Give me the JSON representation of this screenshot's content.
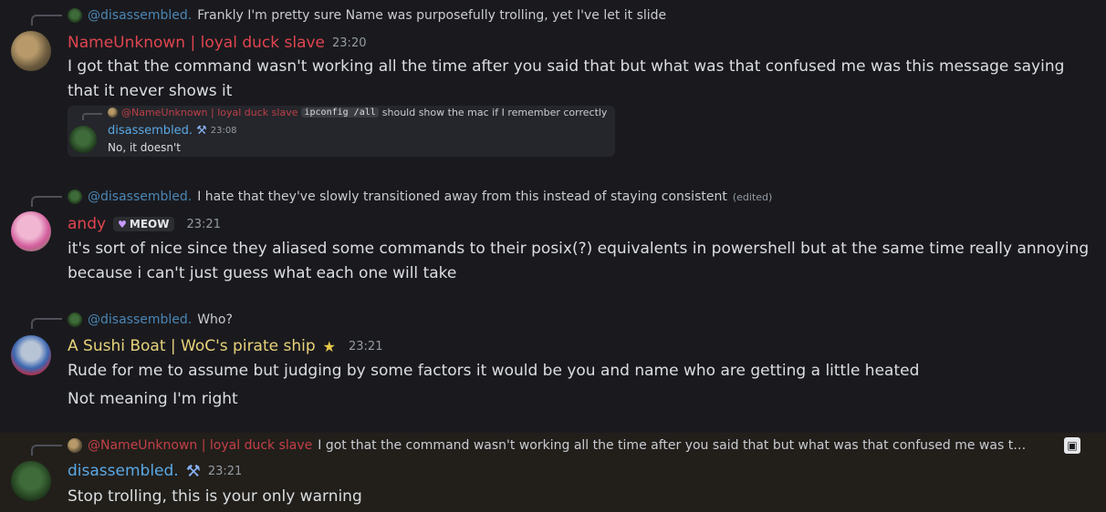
{
  "colors": {
    "background": "#1a1a1e",
    "highlight_background": "#221f1b",
    "nameunknown": "#e0454f",
    "disassembled": "#5aa9e6",
    "andy": "#e0454f",
    "sushi": "#e8d27a"
  },
  "messages": [
    {
      "reply": {
        "name": "@disassembled.",
        "text": "Frankly I'm pretty sure Name was purposefully trolling, yet I've let it slide"
      },
      "author": "NameUnknown | loyal duck slave",
      "time": "23:20",
      "body": "I got that the command wasn't working all the time after you said that but what was that confused me was this message saying that it never shows it",
      "embed": {
        "reply_name": "@NameUnknown | loyal duck slave",
        "reply_code": "ipconfig /all",
        "reply_text": "should show the mac if I remember correctly",
        "author": "disassembled.",
        "tool_icon": "hammer-wrench-icon",
        "time": "23:08",
        "text": "No, it doesn't"
      }
    },
    {
      "reply": {
        "name": "@disassembled.",
        "text": "I hate that they've slowly transitioned away from this instead of staying consistent",
        "edited": "(edited)"
      },
      "author": "andy",
      "badge": "MEOW",
      "badge_icon": "heart-icon",
      "time": "23:21",
      "body": "it's sort of nice since they aliased some commands to their posix(?) equivalents in powershell but at the same time really annoying because i can't just guess what each one will take"
    },
    {
      "reply": {
        "name": "@disassembled.",
        "text": "Who?"
      },
      "author": "A Sushi Boat | WoC's pirate ship",
      "author_icon": "star-icon",
      "time": "23:21",
      "body": "Rude for me to assume but judging by some factors it would be you and name who are getting a little heated",
      "body2": "Not meaning I'm right"
    },
    {
      "reply": {
        "name": "@NameUnknown | loyal duck slave",
        "text": "I got that the command wasn't working all the time after you said that but what was that confused me was t…"
      },
      "author": "disassembled.",
      "tool_icon": "hammer-wrench-icon",
      "time": "23:21",
      "body": "Stop trolling, this is your only warning",
      "reply_attachment_icon": "image-icon"
    }
  ]
}
